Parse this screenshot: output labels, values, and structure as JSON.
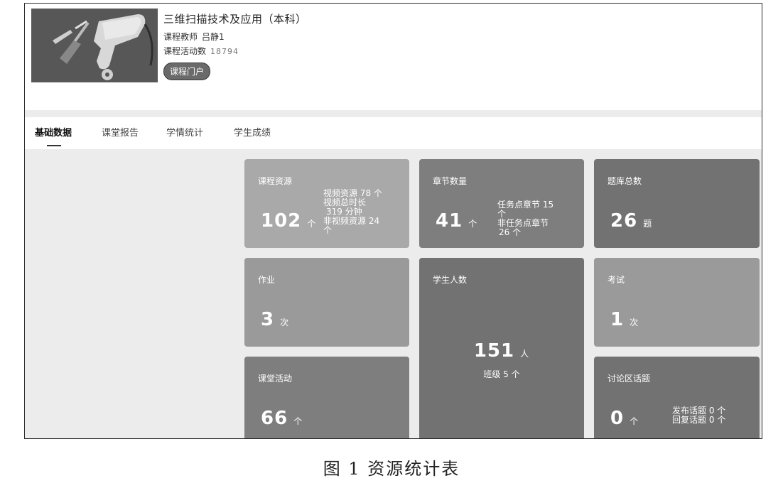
{
  "course": {
    "title": "三维扫描技术及应用（本科）",
    "teacher_label": "课程教师",
    "teacher_name": "吕静1",
    "activity_label": "课程活动数",
    "activity_count": "18794",
    "portal_button": "课程门户"
  },
  "tabs": [
    {
      "label": "基础数据",
      "active": true
    },
    {
      "label": "课堂报告",
      "active": false
    },
    {
      "label": "学情统计",
      "active": false
    },
    {
      "label": "学生成绩",
      "active": false
    }
  ],
  "cards": {
    "resources": {
      "title": "课程资源",
      "value": "102",
      "unit": "个",
      "sub": [
        "视频资源 78 个",
        "视频总时长",
        "319 分钟",
        "非视频资源 24",
        "个"
      ]
    },
    "chapters": {
      "title": "章节数量",
      "value": "41",
      "unit": "个",
      "sub": [
        "任务点章节 15",
        "个",
        "非任务点章节",
        "26 个"
      ]
    },
    "question_bank": {
      "title": "题库总数",
      "value": "26",
      "unit": "题"
    },
    "homework": {
      "title": "作业",
      "value": "3",
      "unit": "次"
    },
    "students": {
      "title": "学生人数",
      "value": "151",
      "unit": "人",
      "sub": "班级 5 个"
    },
    "exam": {
      "title": "考试",
      "value": "1",
      "unit": "次"
    },
    "class_activity": {
      "title": "课堂活动",
      "value": "66",
      "unit": "个"
    },
    "discussion": {
      "title": "讨论区话题",
      "value": "0",
      "unit": "个",
      "sub": [
        "发布话题 0 个",
        "回复话题 0 个"
      ]
    }
  },
  "caption": "图 1   资源统计表"
}
